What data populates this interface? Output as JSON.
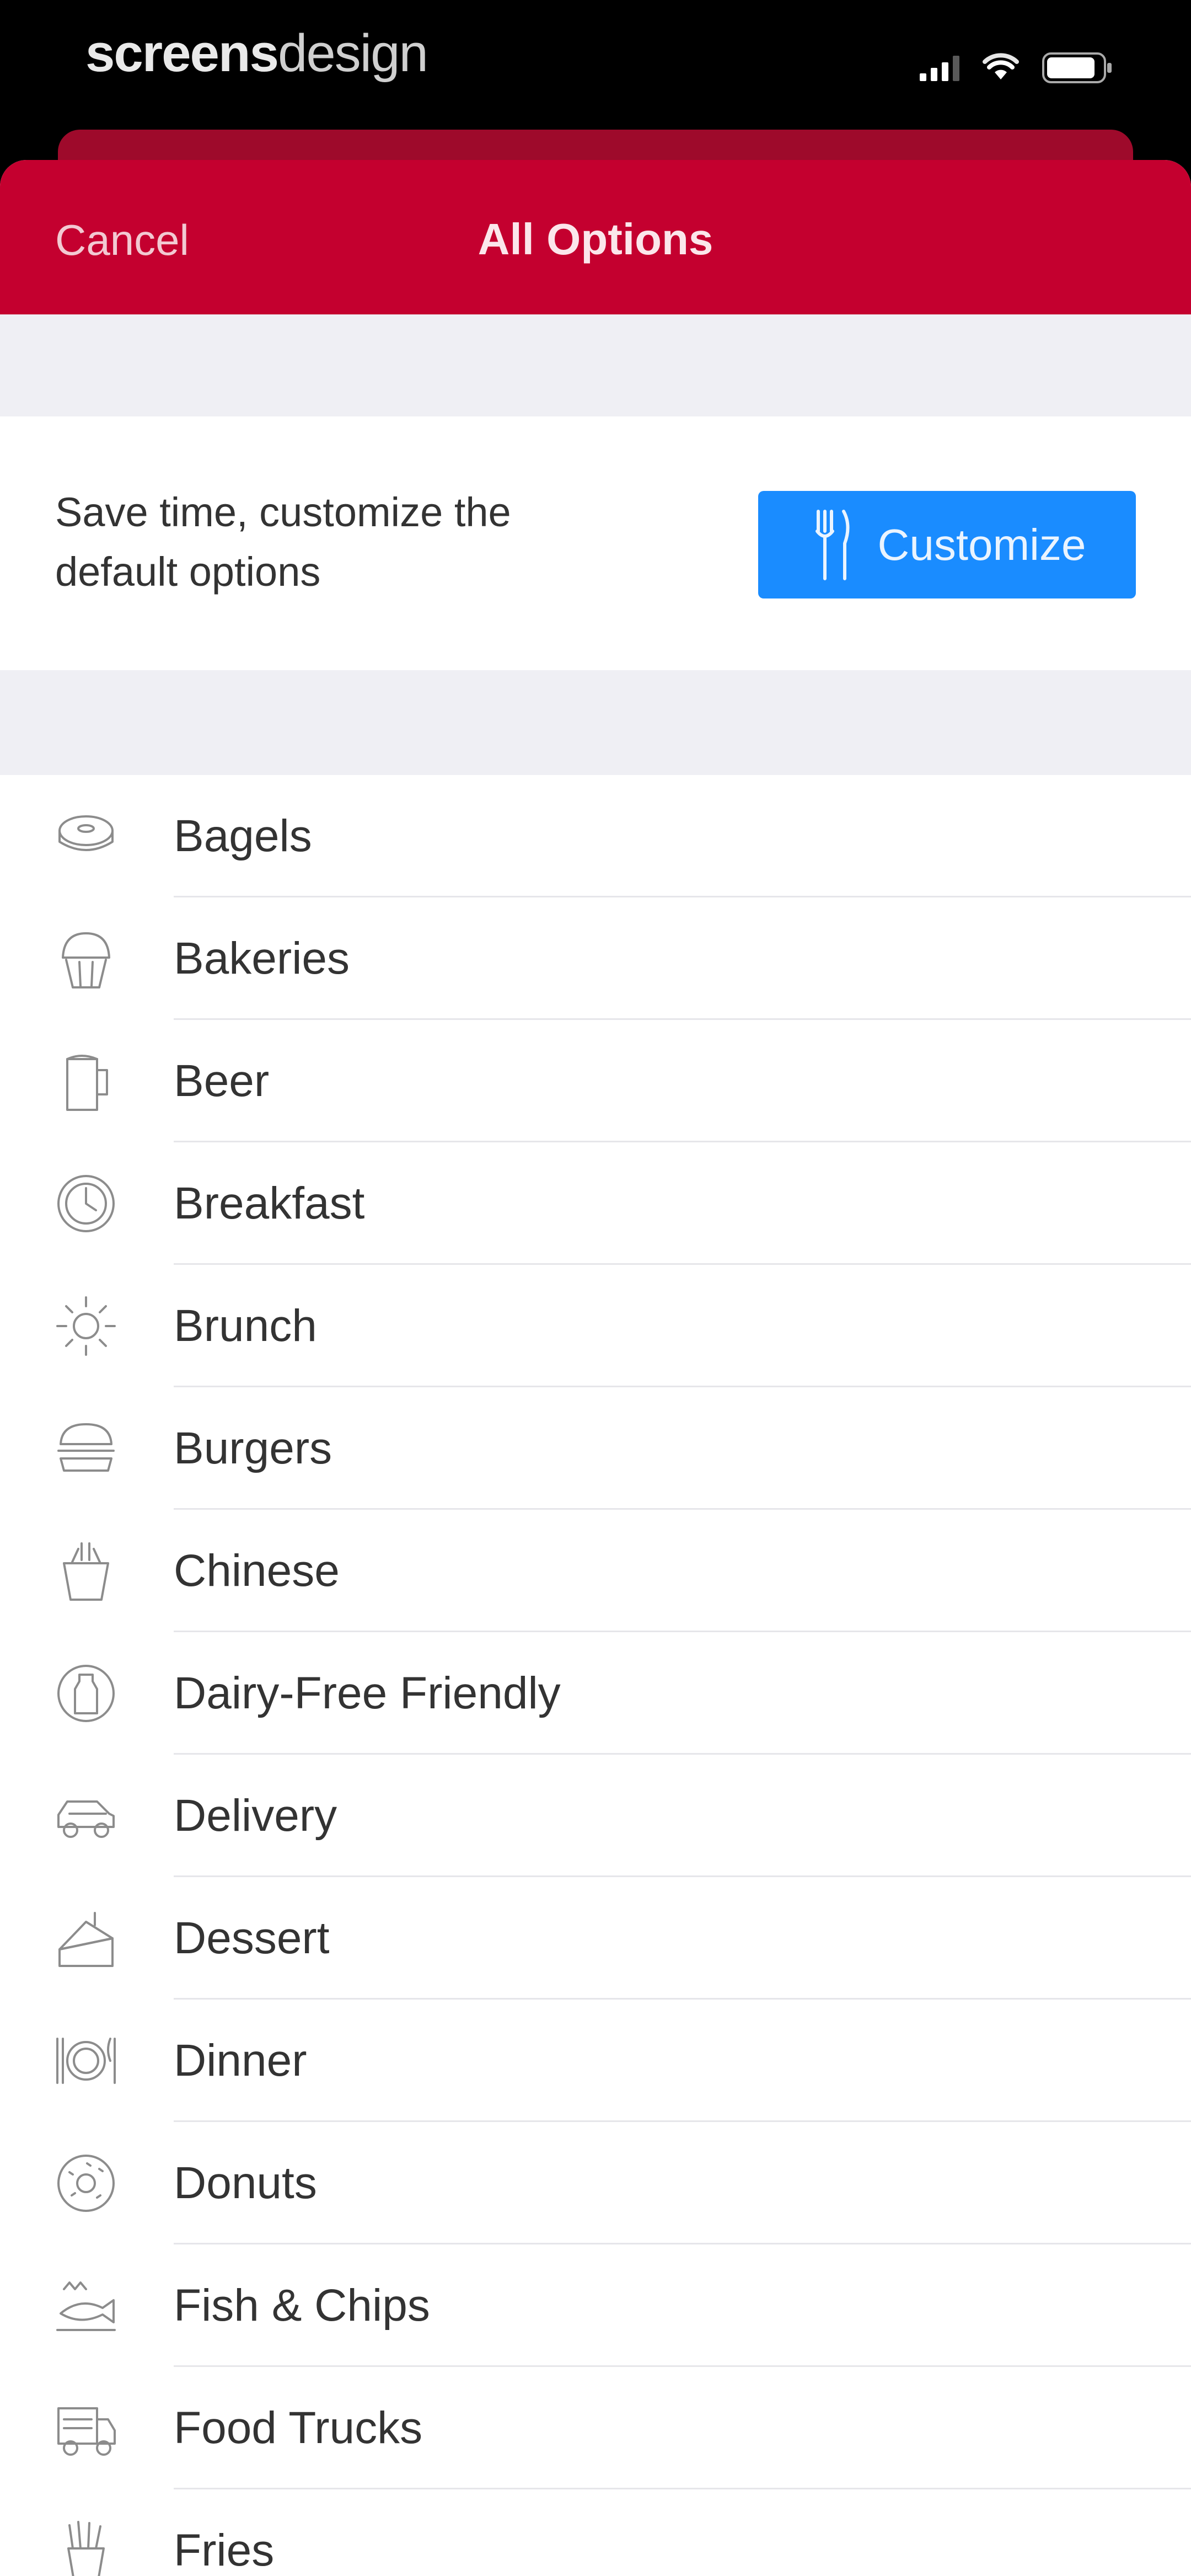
{
  "status_bar": {
    "watermark_bold": "screens",
    "watermark_light": "design"
  },
  "nav": {
    "cancel_label": "Cancel",
    "title": "All Options"
  },
  "promo": {
    "text": "Save time, customize the default options",
    "button_label": "Customize",
    "button_icon": "utensils-icon"
  },
  "colors": {
    "nav_red": "#c4002f",
    "button_blue": "#1a8cff",
    "group_gray": "#efeff4"
  },
  "options": [
    {
      "label": "Bagels",
      "icon": "bagel-icon"
    },
    {
      "label": "Bakeries",
      "icon": "cupcake-icon"
    },
    {
      "label": "Beer",
      "icon": "beer-mug-icon"
    },
    {
      "label": "Breakfast",
      "icon": "clock-plate-icon"
    },
    {
      "label": "Brunch",
      "icon": "sun-icon"
    },
    {
      "label": "Burgers",
      "icon": "burger-icon"
    },
    {
      "label": "Chinese",
      "icon": "takeout-box-icon"
    },
    {
      "label": "Dairy-Free Friendly",
      "icon": "milk-bottle-icon"
    },
    {
      "label": "Delivery",
      "icon": "car-icon"
    },
    {
      "label": "Dessert",
      "icon": "cake-slice-icon"
    },
    {
      "label": "Dinner",
      "icon": "plate-cutlery-icon"
    },
    {
      "label": "Donuts",
      "icon": "donut-icon"
    },
    {
      "label": "Fish & Chips",
      "icon": "fish-icon"
    },
    {
      "label": "Food Trucks",
      "icon": "food-truck-icon"
    },
    {
      "label": "Fries",
      "icon": "fries-icon"
    }
  ]
}
